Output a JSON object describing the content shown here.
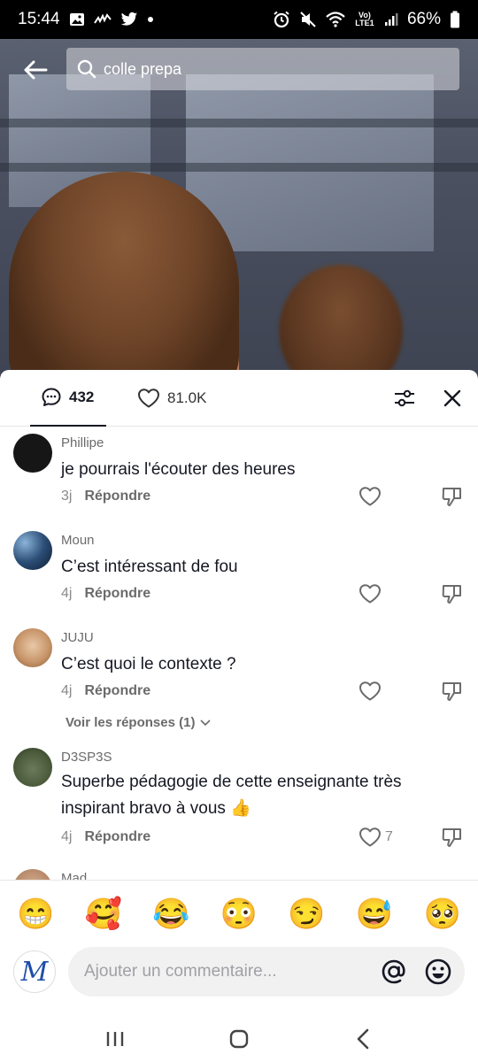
{
  "status": {
    "time": "15:44",
    "battery": "66%",
    "network_label": "Vo) LTE1"
  },
  "search": {
    "query": "colle prepa"
  },
  "tabs": {
    "comments_count": "432",
    "likes_count": "81.0K"
  },
  "comments": [
    {
      "user": "Phillipe",
      "text": "je pourrais l'écouter des heures",
      "age": "3j",
      "reply_label": "Répondre",
      "likes": ""
    },
    {
      "user": "Moun",
      "text": "C’est intéressant de fou",
      "age": "4j",
      "reply_label": "Répondre",
      "likes": ""
    },
    {
      "user": "JUJU",
      "text": "C’est quoi le contexte ?",
      "age": "4j",
      "reply_label": "Répondre",
      "likes": "",
      "replies_label": "Voir les réponses (1)"
    },
    {
      "user": "D3SP3S",
      "text": "Superbe pédagogie de cette enseignante très inspirant bravo à vous 👍",
      "age": "4j",
      "reply_label": "Répondre",
      "likes": "7"
    },
    {
      "user": "Mad"
    }
  ],
  "emojis": [
    "😁",
    "🥰",
    "😂",
    "😳",
    "😏",
    "😅",
    "🥺"
  ],
  "composer": {
    "placeholder": "Ajouter un commentaire...",
    "avatar_letter": "M"
  },
  "colors": {
    "accent": "#161823",
    "muted": "#8a8a8a",
    "sheet_bg": "#ffffff"
  }
}
